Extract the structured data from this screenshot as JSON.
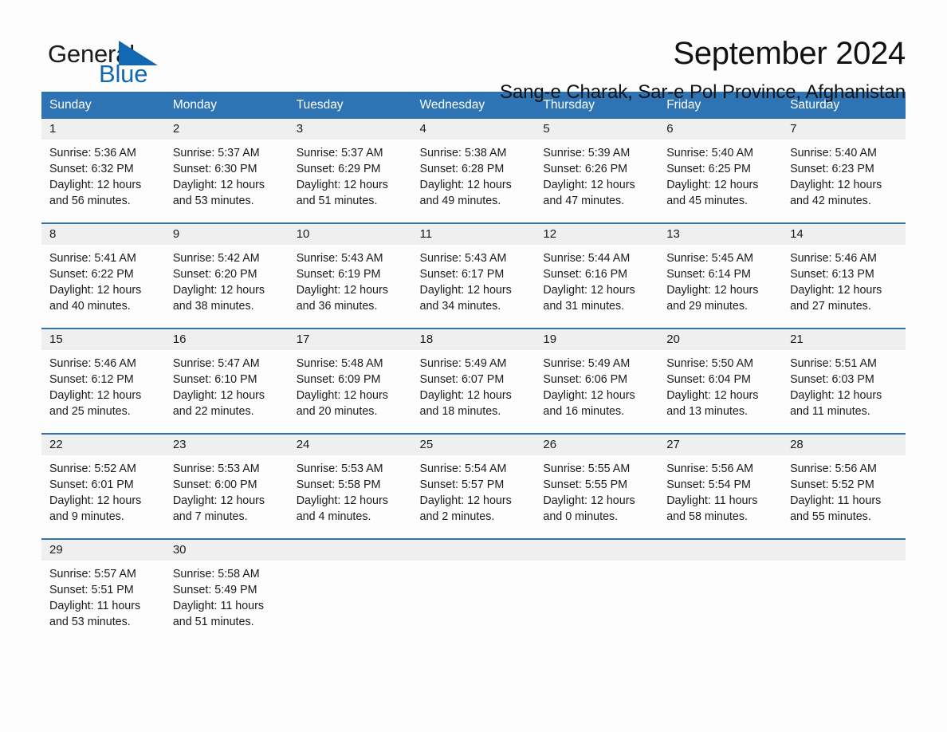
{
  "brand": {
    "word_one": "General",
    "word_two": "Blue",
    "flag_icon": "blue-triangle-flag-icon",
    "accent_color": "#1268b3"
  },
  "header": {
    "title": "September 2024",
    "subtitle": "Sang-e Charak, Sar-e Pol Province, Afghanistan"
  },
  "colors": {
    "header_blue": "#2e74b5",
    "daynum_band": "#efefef",
    "page_background": "#fdfdfd",
    "text": "#1b1b1b"
  },
  "calendar": {
    "weekday_headers": [
      "Sunday",
      "Monday",
      "Tuesday",
      "Wednesday",
      "Thursday",
      "Friday",
      "Saturday"
    ],
    "weeks": [
      [
        {
          "day": "1",
          "sunrise": "Sunrise: 5:36 AM",
          "sunset": "Sunset: 6:32 PM",
          "daylight_line1": "Daylight: 12 hours",
          "daylight_line2": "and 56 minutes."
        },
        {
          "day": "2",
          "sunrise": "Sunrise: 5:37 AM",
          "sunset": "Sunset: 6:30 PM",
          "daylight_line1": "Daylight: 12 hours",
          "daylight_line2": "and 53 minutes."
        },
        {
          "day": "3",
          "sunrise": "Sunrise: 5:37 AM",
          "sunset": "Sunset: 6:29 PM",
          "daylight_line1": "Daylight: 12 hours",
          "daylight_line2": "and 51 minutes."
        },
        {
          "day": "4",
          "sunrise": "Sunrise: 5:38 AM",
          "sunset": "Sunset: 6:28 PM",
          "daylight_line1": "Daylight: 12 hours",
          "daylight_line2": "and 49 minutes."
        },
        {
          "day": "5",
          "sunrise": "Sunrise: 5:39 AM",
          "sunset": "Sunset: 6:26 PM",
          "daylight_line1": "Daylight: 12 hours",
          "daylight_line2": "and 47 minutes."
        },
        {
          "day": "6",
          "sunrise": "Sunrise: 5:40 AM",
          "sunset": "Sunset: 6:25 PM",
          "daylight_line1": "Daylight: 12 hours",
          "daylight_line2": "and 45 minutes."
        },
        {
          "day": "7",
          "sunrise": "Sunrise: 5:40 AM",
          "sunset": "Sunset: 6:23 PM",
          "daylight_line1": "Daylight: 12 hours",
          "daylight_line2": "and 42 minutes."
        }
      ],
      [
        {
          "day": "8",
          "sunrise": "Sunrise: 5:41 AM",
          "sunset": "Sunset: 6:22 PM",
          "daylight_line1": "Daylight: 12 hours",
          "daylight_line2": "and 40 minutes."
        },
        {
          "day": "9",
          "sunrise": "Sunrise: 5:42 AM",
          "sunset": "Sunset: 6:20 PM",
          "daylight_line1": "Daylight: 12 hours",
          "daylight_line2": "and 38 minutes."
        },
        {
          "day": "10",
          "sunrise": "Sunrise: 5:43 AM",
          "sunset": "Sunset: 6:19 PM",
          "daylight_line1": "Daylight: 12 hours",
          "daylight_line2": "and 36 minutes."
        },
        {
          "day": "11",
          "sunrise": "Sunrise: 5:43 AM",
          "sunset": "Sunset: 6:17 PM",
          "daylight_line1": "Daylight: 12 hours",
          "daylight_line2": "and 34 minutes."
        },
        {
          "day": "12",
          "sunrise": "Sunrise: 5:44 AM",
          "sunset": "Sunset: 6:16 PM",
          "daylight_line1": "Daylight: 12 hours",
          "daylight_line2": "and 31 minutes."
        },
        {
          "day": "13",
          "sunrise": "Sunrise: 5:45 AM",
          "sunset": "Sunset: 6:14 PM",
          "daylight_line1": "Daylight: 12 hours",
          "daylight_line2": "and 29 minutes."
        },
        {
          "day": "14",
          "sunrise": "Sunrise: 5:46 AM",
          "sunset": "Sunset: 6:13 PM",
          "daylight_line1": "Daylight: 12 hours",
          "daylight_line2": "and 27 minutes."
        }
      ],
      [
        {
          "day": "15",
          "sunrise": "Sunrise: 5:46 AM",
          "sunset": "Sunset: 6:12 PM",
          "daylight_line1": "Daylight: 12 hours",
          "daylight_line2": "and 25 minutes."
        },
        {
          "day": "16",
          "sunrise": "Sunrise: 5:47 AM",
          "sunset": "Sunset: 6:10 PM",
          "daylight_line1": "Daylight: 12 hours",
          "daylight_line2": "and 22 minutes."
        },
        {
          "day": "17",
          "sunrise": "Sunrise: 5:48 AM",
          "sunset": "Sunset: 6:09 PM",
          "daylight_line1": "Daylight: 12 hours",
          "daylight_line2": "and 20 minutes."
        },
        {
          "day": "18",
          "sunrise": "Sunrise: 5:49 AM",
          "sunset": "Sunset: 6:07 PM",
          "daylight_line1": "Daylight: 12 hours",
          "daylight_line2": "and 18 minutes."
        },
        {
          "day": "19",
          "sunrise": "Sunrise: 5:49 AM",
          "sunset": "Sunset: 6:06 PM",
          "daylight_line1": "Daylight: 12 hours",
          "daylight_line2": "and 16 minutes."
        },
        {
          "day": "20",
          "sunrise": "Sunrise: 5:50 AM",
          "sunset": "Sunset: 6:04 PM",
          "daylight_line1": "Daylight: 12 hours",
          "daylight_line2": "and 13 minutes."
        },
        {
          "day": "21",
          "sunrise": "Sunrise: 5:51 AM",
          "sunset": "Sunset: 6:03 PM",
          "daylight_line1": "Daylight: 12 hours",
          "daylight_line2": "and 11 minutes."
        }
      ],
      [
        {
          "day": "22",
          "sunrise": "Sunrise: 5:52 AM",
          "sunset": "Sunset: 6:01 PM",
          "daylight_line1": "Daylight: 12 hours",
          "daylight_line2": "and 9 minutes."
        },
        {
          "day": "23",
          "sunrise": "Sunrise: 5:53 AM",
          "sunset": "Sunset: 6:00 PM",
          "daylight_line1": "Daylight: 12 hours",
          "daylight_line2": "and 7 minutes."
        },
        {
          "day": "24",
          "sunrise": "Sunrise: 5:53 AM",
          "sunset": "Sunset: 5:58 PM",
          "daylight_line1": "Daylight: 12 hours",
          "daylight_line2": "and 4 minutes."
        },
        {
          "day": "25",
          "sunrise": "Sunrise: 5:54 AM",
          "sunset": "Sunset: 5:57 PM",
          "daylight_line1": "Daylight: 12 hours",
          "daylight_line2": "and 2 minutes."
        },
        {
          "day": "26",
          "sunrise": "Sunrise: 5:55 AM",
          "sunset": "Sunset: 5:55 PM",
          "daylight_line1": "Daylight: 12 hours",
          "daylight_line2": "and 0 minutes."
        },
        {
          "day": "27",
          "sunrise": "Sunrise: 5:56 AM",
          "sunset": "Sunset: 5:54 PM",
          "daylight_line1": "Daylight: 11 hours",
          "daylight_line2": "and 58 minutes."
        },
        {
          "day": "28",
          "sunrise": "Sunrise: 5:56 AM",
          "sunset": "Sunset: 5:52 PM",
          "daylight_line1": "Daylight: 11 hours",
          "daylight_line2": "and 55 minutes."
        }
      ],
      [
        {
          "day": "29",
          "sunrise": "Sunrise: 5:57 AM",
          "sunset": "Sunset: 5:51 PM",
          "daylight_line1": "Daylight: 11 hours",
          "daylight_line2": "and 53 minutes."
        },
        {
          "day": "30",
          "sunrise": "Sunrise: 5:58 AM",
          "sunset": "Sunset: 5:49 PM",
          "daylight_line1": "Daylight: 11 hours",
          "daylight_line2": "and 51 minutes."
        },
        {
          "day": "",
          "sunrise": "",
          "sunset": "",
          "daylight_line1": "",
          "daylight_line2": ""
        },
        {
          "day": "",
          "sunrise": "",
          "sunset": "",
          "daylight_line1": "",
          "daylight_line2": ""
        },
        {
          "day": "",
          "sunrise": "",
          "sunset": "",
          "daylight_line1": "",
          "daylight_line2": ""
        },
        {
          "day": "",
          "sunrise": "",
          "sunset": "",
          "daylight_line1": "",
          "daylight_line2": ""
        },
        {
          "day": "",
          "sunrise": "",
          "sunset": "",
          "daylight_line1": "",
          "daylight_line2": ""
        }
      ]
    ]
  }
}
